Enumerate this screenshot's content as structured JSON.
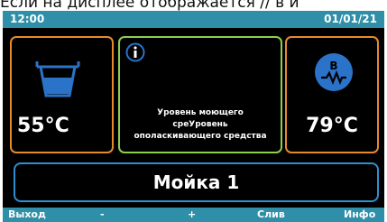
{
  "caption": "Если на дисплее отображается // в и",
  "status": {
    "time": "12:00",
    "date": "01/01/21"
  },
  "left_panel": {
    "temperature": "55°C",
    "icon": "tank-icon"
  },
  "middle_panel": {
    "icon": "info-icon",
    "message_lines": [
      "Уровень моющего",
      "среУровень",
      "ополаскивающего средства"
    ]
  },
  "right_panel": {
    "temperature": "79°C",
    "icon_letter": "B",
    "icon": "boiler-icon"
  },
  "program": {
    "label": "Мойка 1"
  },
  "softkeys": {
    "exit": "Выход",
    "minus": "-",
    "plus": "+",
    "drain": "Слив",
    "info": "Инфо"
  },
  "colors": {
    "accent": "#2f8fa8",
    "orange": "#e8892c",
    "green": "#8ccf4f",
    "blue": "#2f8fd0",
    "icon_blue": "#2a73c9"
  }
}
